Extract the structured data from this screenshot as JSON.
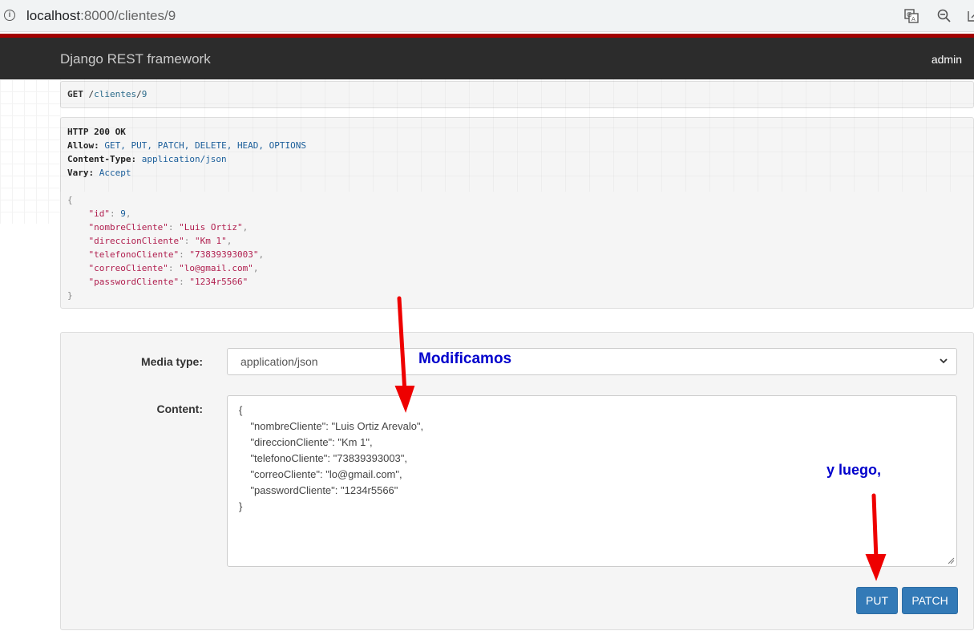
{
  "browser": {
    "url_host": "localhost",
    "url_path": ":8000/clientes/9",
    "icons": [
      "info-icon",
      "translate-icon",
      "zoom-out-icon",
      "share-icon"
    ]
  },
  "navbar": {
    "brand": "Django REST framework",
    "user": "admin"
  },
  "request": {
    "method": "GET",
    "path_sep1": " /",
    "path_seg1": "clientes",
    "path_sep2": "/",
    "path_seg2": "9"
  },
  "response": {
    "status": "HTTP 200 OK",
    "headers": [
      {
        "key": "Allow:",
        "value": "GET, PUT, PATCH, DELETE, HEAD, OPTIONS"
      },
      {
        "key": "Content-Type:",
        "value": "application/json"
      },
      {
        "key": "Vary:",
        "value": "Accept"
      }
    ],
    "open_brace": "{",
    "close_brace": "}",
    "body": [
      {
        "key": "\"id\"",
        "value": "9",
        "type": "num",
        "comma": ","
      },
      {
        "key": "\"nombreCliente\"",
        "value": "\"Luis Ortiz\"",
        "type": "str",
        "comma": ","
      },
      {
        "key": "\"direccionCliente\"",
        "value": "\"Km 1\"",
        "type": "str",
        "comma": ","
      },
      {
        "key": "\"telefonoCliente\"",
        "value": "\"73839393003\"",
        "type": "str",
        "comma": ","
      },
      {
        "key": "\"correoCliente\"",
        "value": "\"lo@gmail.com\"",
        "type": "str",
        "comma": ","
      },
      {
        "key": "\"passwordCliente\"",
        "value": "\"1234r5566\"",
        "type": "str",
        "comma": ""
      }
    ]
  },
  "form": {
    "media_type_label": "Media type:",
    "media_type_value": "application/json",
    "content_label": "Content:",
    "content_lines": [
      "{",
      "    \"nombreCliente\": \"Luis Ortiz Arevalo\",",
      "    \"direccionCliente\": \"Km 1\",",
      "    \"telefonoCliente\": \"73839393003\",",
      "    \"correoCliente\": \"lo@gmail.com\",",
      "    \"passwordCliente\": \"1234r5566\"",
      "}"
    ],
    "put_label": "PUT",
    "patch_label": "PATCH"
  },
  "annotations": {
    "modify": "Modificamos",
    "then": "y luego,",
    "color": "#0000cc",
    "arrow_color": "#ee0000"
  }
}
